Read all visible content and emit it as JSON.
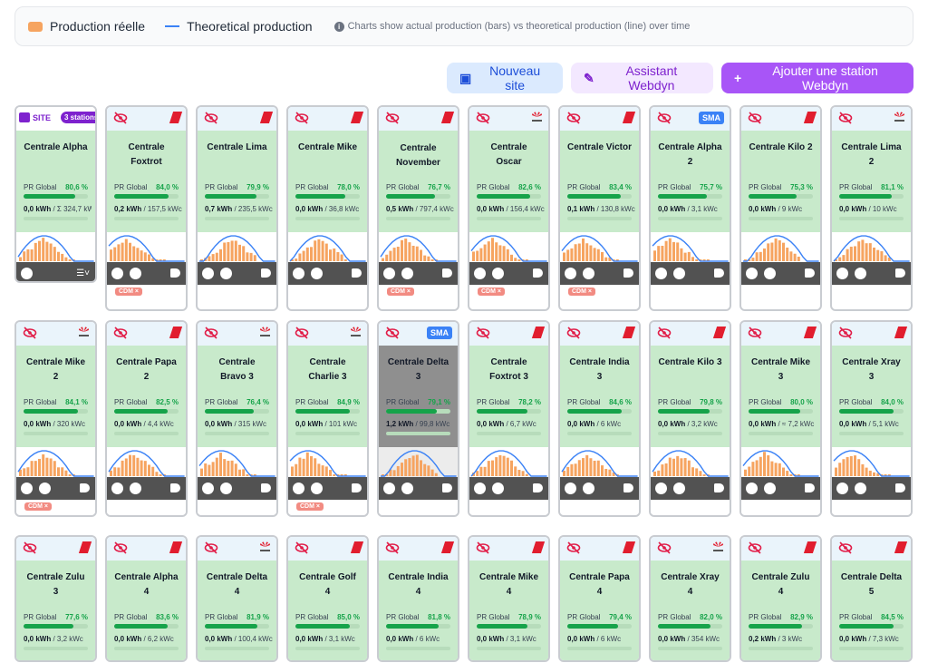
{
  "legend": {
    "bar_label": "Production réelle",
    "line_label": "Theoretical production",
    "note": "Charts show actual production (bars) vs theoretical production (line) over time",
    "bar_color": "#f6a460",
    "line_color": "#3b82f6"
  },
  "actions": {
    "new_site": "Nouveau site",
    "assistant": "Assistant Webdyn",
    "add_station": "Ajouter une station Webdyn"
  },
  "site_card": {
    "label": "SITE",
    "badge": "3 stations",
    "name": "Centrale Alpha",
    "pr_label": "PR Global",
    "pr": "80,6 %",
    "pr_fraction": 0.806,
    "kwh": "0,0 kWh",
    "capacity": "/ Σ 324,7 kWc"
  },
  "stations": [
    {
      "name": "Centrale Foxtrot",
      "brand": "red",
      "pr": "84,0 %",
      "pr_fraction": 0.84,
      "kwh": "0,2 kWh",
      "capacity": "/ 157,5 kWc",
      "cdm": "CDM ×"
    },
    {
      "name": "Centrale Lima",
      "brand": "red",
      "pr": "79,9 %",
      "pr_fraction": 0.799,
      "kwh": "0,7 kWh",
      "capacity": "/ 235,5 kWc",
      "cdm": ""
    },
    {
      "name": "Centrale Mike",
      "brand": "red",
      "pr": "78,0 %",
      "pr_fraction": 0.78,
      "kwh": "0,0 kWh",
      "capacity": "/ 36,8 kWc",
      "cdm": ""
    },
    {
      "name": "Centrale November",
      "brand": "red",
      "pr": "76,7 %",
      "pr_fraction": 0.767,
      "kwh": "0,5 kWh",
      "capacity": "/ 797,4 kWc",
      "cdm": "CDM ×"
    },
    {
      "name": "Centrale Oscar",
      "brand": "huawei",
      "pr": "82,6 %",
      "pr_fraction": 0.826,
      "kwh": "0,0 kWh",
      "capacity": "/ 156,4 kWc",
      "cdm": "CDM ×"
    },
    {
      "name": "Centrale Victor",
      "brand": "red",
      "pr": "83,4 %",
      "pr_fraction": 0.834,
      "kwh": "0,1 kWh",
      "capacity": "/ 130,8 kWc",
      "cdm": "CDM ×"
    },
    {
      "name": "Centrale Alpha 2",
      "brand": "sma",
      "pr": "75,7 %",
      "pr_fraction": 0.757,
      "kwh": "0,0 kWh",
      "capacity": "/ 3,1 kWc",
      "cdm": ""
    },
    {
      "name": "Centrale Kilo 2",
      "brand": "red",
      "pr": "75,3 %",
      "pr_fraction": 0.753,
      "kwh": "0,0 kWh",
      "capacity": "/ 9 kWc",
      "cdm": ""
    },
    {
      "name": "Centrale Lima 2",
      "brand": "huawei",
      "pr": "81,1 %",
      "pr_fraction": 0.811,
      "kwh": "0,0 kWh",
      "capacity": "/ 10 kWc",
      "cdm": ""
    },
    {
      "name": "Centrale Mike 2",
      "brand": "huawei",
      "pr": "84,1 %",
      "pr_fraction": 0.841,
      "kwh": "0,0 kWh",
      "capacity": "/ 320 kWc",
      "cdm": "CDM ×"
    },
    {
      "name": "Centrale Papa 2",
      "brand": "red",
      "pr": "82,5 %",
      "pr_fraction": 0.825,
      "kwh": "0,0 kWh",
      "capacity": "/ 4,4 kWc",
      "cdm": ""
    },
    {
      "name": "Centrale Bravo 3",
      "brand": "huawei",
      "pr": "76,4 %",
      "pr_fraction": 0.764,
      "kwh": "0,0 kWh",
      "capacity": "/ 315 kWc",
      "cdm": ""
    },
    {
      "name": "Centrale Charlie 3",
      "brand": "huawei",
      "pr": "84,9 %",
      "pr_fraction": 0.849,
      "kwh": "0,0 kWh",
      "capacity": "/ 101 kWc",
      "cdm": "CDM ×"
    },
    {
      "name": "Centrale Delta 3",
      "brand": "sma",
      "pr": "79,1 %",
      "pr_fraction": 0.791,
      "kwh": "1,2 kWh",
      "capacity": "/ 99,8 kWc",
      "cdm": "",
      "dim": true
    },
    {
      "name": "Centrale Foxtrot 3",
      "brand": "red",
      "pr": "78,2 %",
      "pr_fraction": 0.782,
      "kwh": "0,0 kWh",
      "capacity": "/ 6,7 kWc",
      "cdm": ""
    },
    {
      "name": "Centrale India 3",
      "brand": "red",
      "pr": "84,6 %",
      "pr_fraction": 0.846,
      "kwh": "0,0 kWh",
      "capacity": "/ 6 kWc",
      "cdm": ""
    },
    {
      "name": "Centrale Kilo 3",
      "brand": "red",
      "pr": "79,8 %",
      "pr_fraction": 0.798,
      "kwh": "0,0 kWh",
      "capacity": "/ 3,2 kWc",
      "cdm": ""
    },
    {
      "name": "Centrale Mike 3",
      "brand": "red",
      "pr": "80,0 %",
      "pr_fraction": 0.8,
      "kwh": "0,0 kWh",
      "capacity": "/ ≈ 7,2 kWc",
      "cdm": ""
    },
    {
      "name": "Centrale Xray 3",
      "brand": "red",
      "pr": "84,0 %",
      "pr_fraction": 0.84,
      "kwh": "0,0 kWh",
      "capacity": "/ 5,1 kWc",
      "cdm": ""
    },
    {
      "name": "Centrale Zulu 3",
      "brand": "red",
      "pr": "77,6 %",
      "pr_fraction": 0.776,
      "kwh": "0,0 kWh",
      "capacity": "/ 3,2 kWc",
      "cdm": ""
    },
    {
      "name": "Centrale Alpha 4",
      "brand": "red",
      "pr": "83,6 %",
      "pr_fraction": 0.836,
      "kwh": "0,0 kWh",
      "capacity": "/ 6,2 kWc",
      "cdm": ""
    },
    {
      "name": "Centrale Delta 4",
      "brand": "huawei",
      "pr": "81,9 %",
      "pr_fraction": 0.819,
      "kwh": "0,0 kWh",
      "capacity": "/ 100,4 kWc",
      "cdm": ""
    },
    {
      "name": "Centrale Golf 4",
      "brand": "red",
      "pr": "85,0 %",
      "pr_fraction": 0.85,
      "kwh": "0,0 kWh",
      "capacity": "/ 3,1 kWc",
      "cdm": ""
    },
    {
      "name": "Centrale India 4",
      "brand": "red",
      "pr": "81,8 %",
      "pr_fraction": 0.818,
      "kwh": "0,0 kWh",
      "capacity": "/ 6 kWc",
      "cdm": ""
    },
    {
      "name": "Centrale Mike 4",
      "brand": "red",
      "pr": "78,9 %",
      "pr_fraction": 0.789,
      "kwh": "0,0 kWh",
      "capacity": "/ 3,1 kWc",
      "cdm": ""
    },
    {
      "name": "Centrale Papa 4",
      "brand": "red",
      "pr": "79,4 %",
      "pr_fraction": 0.794,
      "kwh": "0,0 kWh",
      "capacity": "/ 6 kWc",
      "cdm": ""
    },
    {
      "name": "Centrale Xray 4",
      "brand": "huawei",
      "pr": "82,0 %",
      "pr_fraction": 0.82,
      "kwh": "0,0 kWh",
      "capacity": "/ 354 kWc",
      "cdm": ""
    },
    {
      "name": "Centrale Zulu 4",
      "brand": "red",
      "pr": "82,9 %",
      "pr_fraction": 0.829,
      "kwh": "0,2 kWh",
      "capacity": "/ 3 kWc",
      "cdm": ""
    },
    {
      "name": "Centrale Delta 5",
      "brand": "red",
      "pr": "84,5 %",
      "pr_fraction": 0.845,
      "kwh": "0,0 kWh",
      "capacity": "/ 7,3 kWc",
      "cdm": ""
    }
  ],
  "pr_label": "PR Global"
}
